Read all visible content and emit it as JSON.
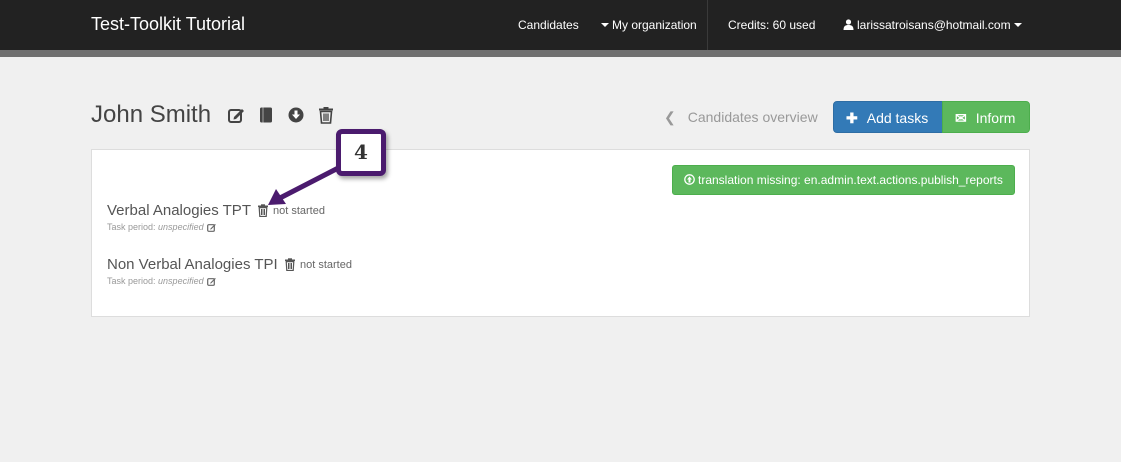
{
  "navbar": {
    "brand": "Test-Toolkit Tutorial",
    "candidates": "Candidates",
    "my_organization": "My organization",
    "credits": "Credits: 60 used",
    "user_email": "larissatroisans@hotmail.com"
  },
  "header": {
    "candidate_name": "John Smith",
    "icons": [
      "edit-icon",
      "book-icon",
      "download-icon",
      "trash-icon"
    ],
    "back_link": "Candidates overview",
    "add_tasks_label": "Add tasks",
    "inform_label": "Inform"
  },
  "panel": {
    "publish_label": "translation missing: en.admin.text.actions.publish_reports",
    "tasks": [
      {
        "name": "Verbal Analogies TPT",
        "status": "not started",
        "period_label": "Task period:",
        "period_value": "unspecified"
      },
      {
        "name": "Non Verbal Analogies TPI",
        "status": "not started",
        "period_label": "Task period:",
        "period_value": "unspecified"
      }
    ]
  },
  "annotation": {
    "step_number": "4"
  },
  "colors": {
    "navbar_bg": "#222222",
    "primary": "#337ab7",
    "success": "#5cb85c",
    "annotation": "#4b1b6e"
  }
}
